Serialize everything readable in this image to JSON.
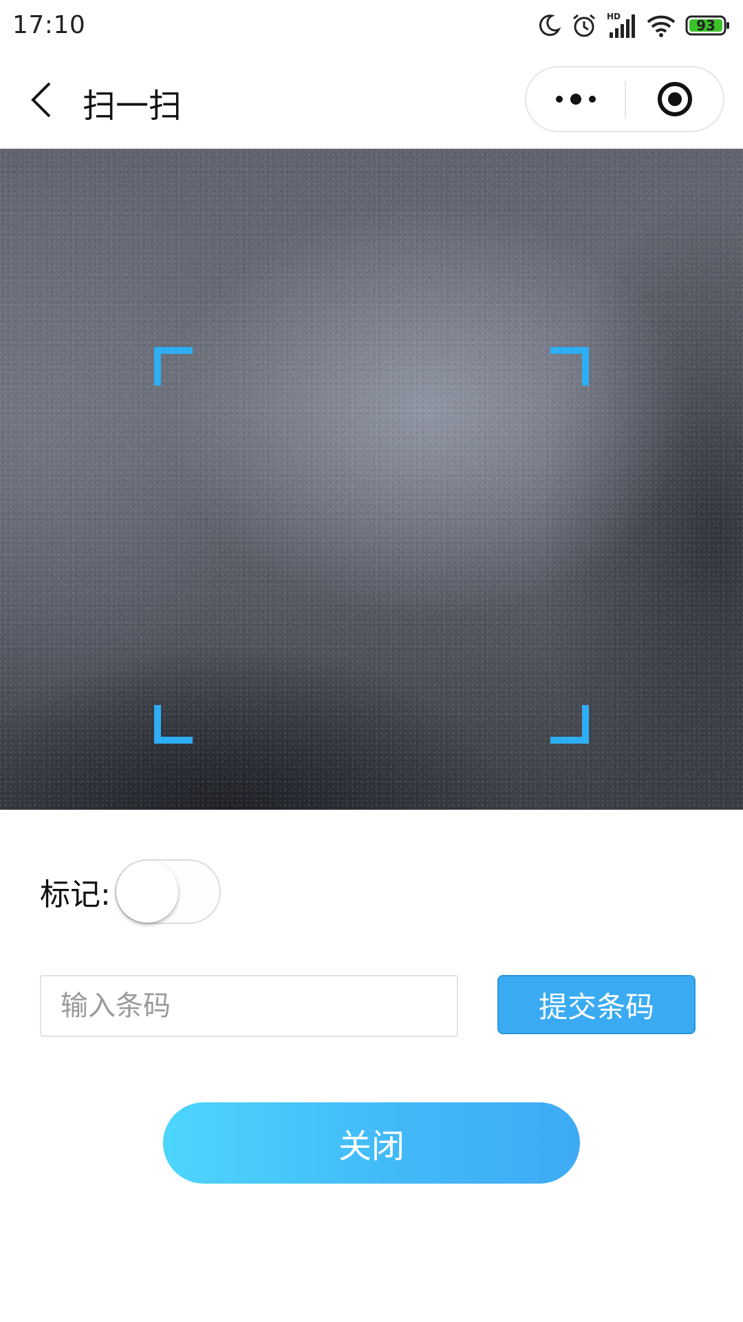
{
  "status_bar": {
    "time": "17:10",
    "icons": [
      "moon-icon",
      "alarm-icon",
      "hd-signal-icon",
      "wifi-icon",
      "battery-icon"
    ],
    "hd_label": "HD",
    "battery_level": "93"
  },
  "nav": {
    "title": "扫一扫",
    "back_icon": "chevron-left-icon",
    "more_icon": "more-dots-icon",
    "close_icon": "target-circle-icon"
  },
  "scanner": {
    "frame_color": "#2eaef5"
  },
  "form": {
    "mark_label": "标记:",
    "mark_switch_on": false,
    "barcode_placeholder": "输入条码",
    "barcode_value": "",
    "submit_label": "提交条码",
    "close_label": "关闭"
  },
  "colors": {
    "accent": "#3aabf2",
    "close_gradient_start": "#4dd6fc",
    "close_gradient_end": "#3eaaf6"
  }
}
